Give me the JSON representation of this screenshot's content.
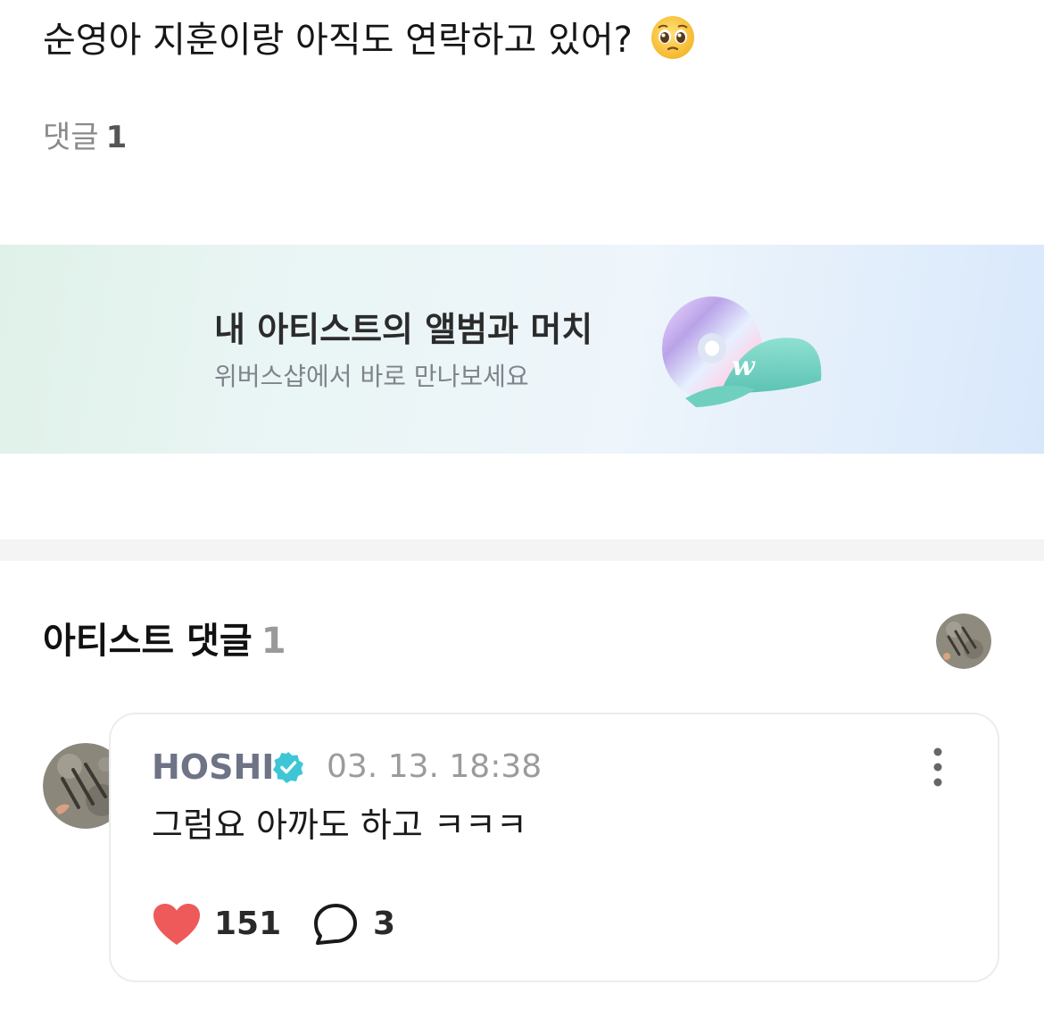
{
  "post": {
    "text": "순영아 지훈이랑 아직도 연락하고 있어?",
    "emoji": "pleading-face"
  },
  "comments_summary": {
    "label": "댓글",
    "count": "1"
  },
  "banner": {
    "title": "내 아티스트의 앨범과 머치",
    "subtitle": "위버스샵에서 바로 만나보세요",
    "icons": [
      "cd-icon",
      "cap-icon"
    ]
  },
  "artist_comments": {
    "heading": "아티스트 댓글",
    "count": "1",
    "comment": {
      "author": "HOSHI",
      "verified": true,
      "timestamp": "03. 13. 18:38",
      "text": "그럼요 아까도 하고 ㅋㅋㅋ",
      "likes": "151",
      "replies": "3"
    }
  },
  "colors": {
    "like_heart": "#ee5a5a",
    "verified_badge": "#3ec6d6",
    "author_name": "#6e7386"
  }
}
